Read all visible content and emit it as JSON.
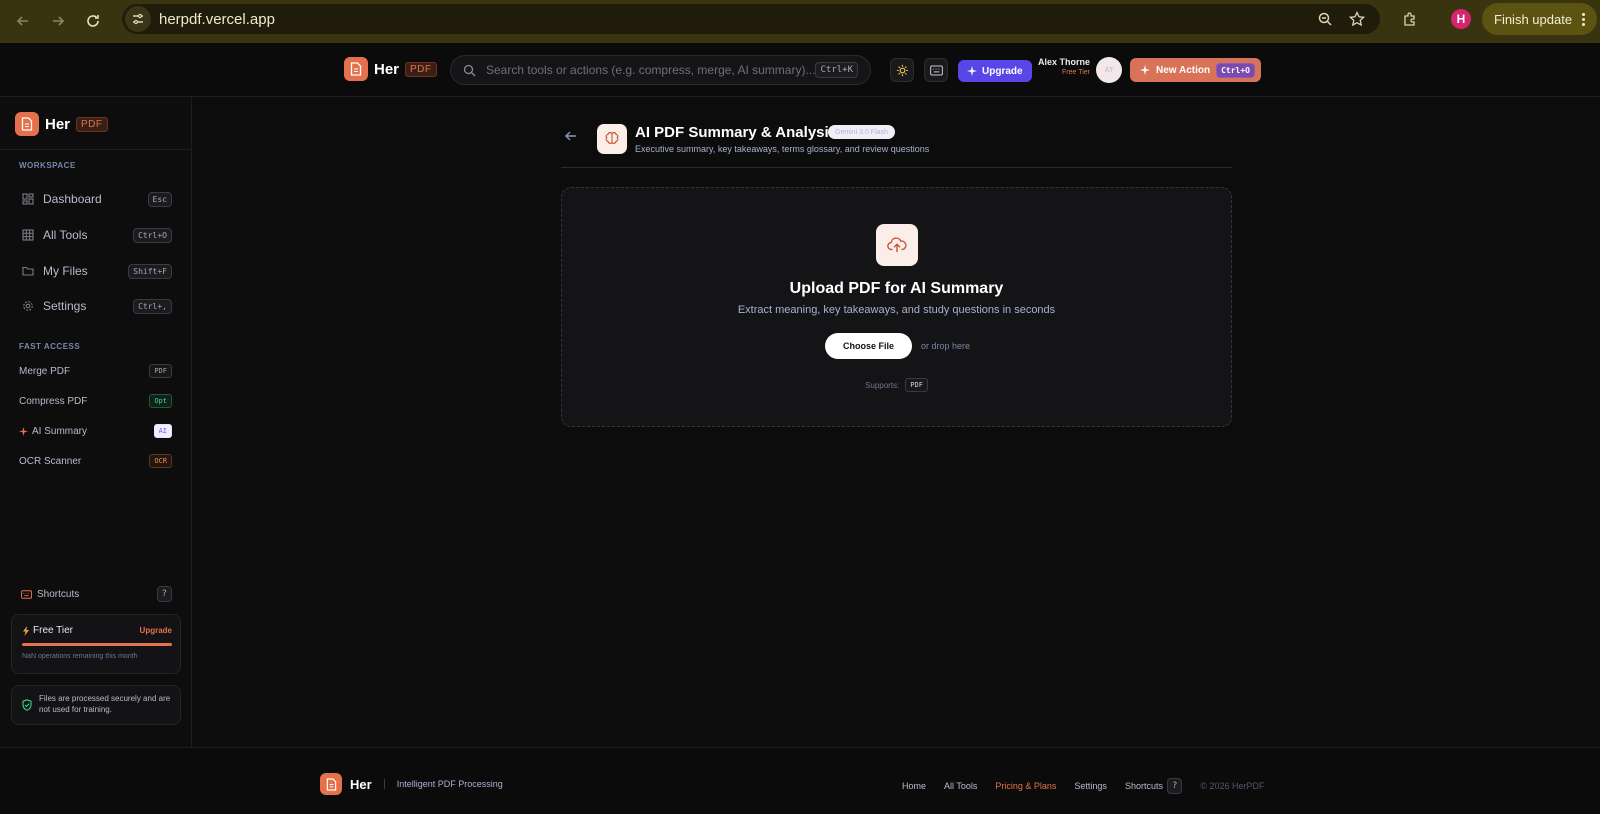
{
  "browser": {
    "url": "herpdf.vercel.app",
    "profile_initial": "H",
    "finish_update_label": "Finish update"
  },
  "brand": {
    "name": "Her",
    "badge": "PDF"
  },
  "header": {
    "search_placeholder": "Search tools or actions (e.g. compress, merge, AI summary)...",
    "search_shortcut": "Ctrl+K",
    "upgrade_label": "Upgrade",
    "user_name": "Alex Thorne",
    "user_tier": "Free Tier",
    "avatar_initials": "AT",
    "new_action_label": "New Action",
    "new_action_shortcut": "Ctrl+O"
  },
  "sidebar": {
    "workspace_title": "WORKSPACE",
    "workspace_items": [
      {
        "label": "Dashboard",
        "shortcut": "Esc",
        "icon": "dashboard-icon"
      },
      {
        "label": "All Tools",
        "shortcut": "Ctrl+O",
        "icon": "grid-icon"
      },
      {
        "label": "My Files",
        "shortcut": "Shift+F",
        "icon": "folder-icon"
      },
      {
        "label": "Settings",
        "shortcut": "Ctrl+,",
        "icon": "gear-icon"
      }
    ],
    "fast_title": "FAST ACCESS",
    "fast_items": [
      {
        "label": "Merge PDF",
        "badge": "PDF"
      },
      {
        "label": "Compress PDF",
        "badge": "Opt"
      },
      {
        "label": "AI Summary",
        "badge": "AI"
      },
      {
        "label": "OCR Scanner",
        "badge": "OCR"
      }
    ],
    "shortcuts_label": "Shortcuts",
    "shortcuts_key": "?",
    "tier": {
      "title": "Free Tier",
      "upgrade": "Upgrade",
      "remaining": "NaN operations remaining this month",
      "progress_percent": 100
    },
    "secure_text": "Files are processed securely and are not used for training."
  },
  "main": {
    "title": "AI PDF Summary & Analysis",
    "model_badge": "Gemini 3.0 Flash",
    "subtitle": "Executive summary, key takeaways, terms glossary, and review questions",
    "upload_title": "Upload PDF for AI Summary",
    "upload_subtitle": "Extract meaning, key takeaways, and study questions in seconds",
    "choose_file": "Choose File",
    "drop_here": "or drop here",
    "supports_label": "Supports:",
    "supports_format": "PDF"
  },
  "footer": {
    "tagline": "Intelligent PDF Processing",
    "links": [
      "Home",
      "All Tools",
      "Pricing & Plans",
      "Settings",
      "Shortcuts"
    ],
    "shortcuts_key": "?",
    "copyright": "© 2026 HerPDF"
  },
  "colors": {
    "accent": "#e5714c",
    "upgrade": "#5847e8",
    "chrome": "#3a3310"
  }
}
